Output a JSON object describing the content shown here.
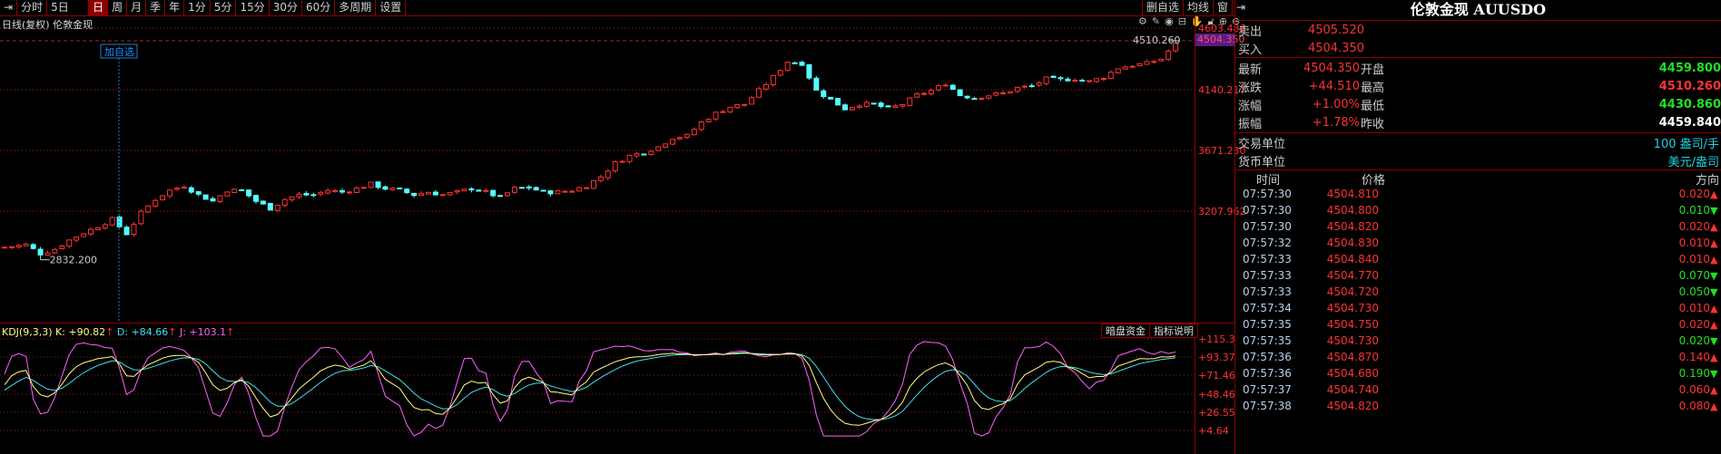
{
  "toolbar": {
    "items": [
      "分时",
      "5日",
      "日",
      "周",
      "月",
      "季",
      "年",
      "1分",
      "5分",
      "15分",
      "30分",
      "60分",
      "多周期",
      "设置"
    ],
    "active": "日",
    "right": [
      "删自选",
      "均线",
      "窗"
    ]
  },
  "chart": {
    "title": "日线(复权)  伦敦金现",
    "tag": "加自选",
    "high_label": "4510.260",
    "low_label": "2832.200",
    "icons": [
      "gear-icon",
      "pen-icon",
      "eye-icon",
      "toolbox-icon",
      "hand-icon",
      "lock-icon",
      "zoom-in-icon",
      "zoom-out-icon"
    ],
    "price_axis": [
      "4603.486",
      "4140.217",
      "3671.230",
      "3207.962"
    ],
    "current_price": "4504.350"
  },
  "chart_data": {
    "type": "candlestick",
    "title": "伦敦金现 日线(复权)",
    "ylim": [
      2832.2,
      4603.486
    ],
    "closes": [
      2935,
      2949,
      2879,
      2914,
      2984,
      3040,
      3089,
      3145,
      3033,
      3194,
      3299,
      3369,
      3404,
      3334,
      3285,
      3369,
      3369,
      3285,
      3229,
      3299,
      3334,
      3334,
      3369,
      3355,
      3383,
      3418,
      3383,
      3369,
      3334,
      3355,
      3334,
      3355,
      3383,
      3355,
      3313,
      3383,
      3390,
      3355,
      3355,
      3369,
      3404,
      3474,
      3579,
      3635,
      3663,
      3705,
      3775,
      3789,
      3894,
      3964,
      4013,
      4034,
      4139,
      4244,
      4363,
      4349,
      4139,
      4069,
      3999,
      4034,
      4034,
      3999,
      4034,
      4104,
      4139,
      4195,
      4104,
      4083,
      4104,
      4118,
      4160,
      4174,
      4230,
      4223,
      4230,
      4209,
      4244,
      4314,
      4335,
      4349,
      4384,
      4504
    ],
    "up_color": "#ff3232",
    "down_color": "#54ffff"
  },
  "kdj": {
    "name": "KDJ(9,3,3)",
    "k": "K: +90.82",
    "d": "D: +84.66",
    "j": "J: +103.1",
    "arrow": "↑",
    "buttons": [
      "暗盘资金",
      "指标说明"
    ],
    "axis": [
      "+115.3",
      "+93.37",
      "+71.46",
      "+48.46",
      "+26.55",
      "+4.64"
    ],
    "colors": {
      "k": "#ffff80",
      "d": "#40e0f0",
      "j": "#ff60ff"
    }
  },
  "panel": {
    "title": "伦敦金现 AUUSDO",
    "sell_label": "卖出",
    "sell": "4505.520",
    "buy_label": "买入",
    "buy": "4504.350",
    "stats": [
      [
        "最新",
        "4504.350",
        "开盘",
        "4459.800"
      ],
      [
        "涨跌",
        "+44.510",
        "最高",
        "4510.260"
      ],
      [
        "涨幅",
        "+1.00%",
        "最低",
        "4430.860"
      ],
      [
        "振幅",
        "+1.78%",
        "昨收",
        "4459.840"
      ]
    ],
    "trade_unit_label": "交易单位",
    "trade_unit": "100 盎司/手",
    "currency_label": "货币单位",
    "currency": "美元/盎司",
    "headers": [
      "时间",
      "价格",
      "方向"
    ],
    "ticks": [
      [
        "07:57:30",
        "4504.810",
        "0.020",
        "up"
      ],
      [
        "07:57:30",
        "4504.800",
        "0.010",
        "down"
      ],
      [
        "07:57:30",
        "4504.820",
        "0.020",
        "up"
      ],
      [
        "07:57:32",
        "4504.830",
        "0.010",
        "up"
      ],
      [
        "07:57:33",
        "4504.840",
        "0.010",
        "up"
      ],
      [
        "07:57:33",
        "4504.770",
        "0.070",
        "down"
      ],
      [
        "07:57:33",
        "4504.720",
        "0.050",
        "down"
      ],
      [
        "07:57:34",
        "4504.730",
        "0.010",
        "up"
      ],
      [
        "07:57:35",
        "4504.750",
        "0.020",
        "up"
      ],
      [
        "07:57:35",
        "4504.730",
        "0.020",
        "down"
      ],
      [
        "07:57:36",
        "4504.870",
        "0.140",
        "up"
      ],
      [
        "07:57:36",
        "4504.680",
        "0.190",
        "down"
      ],
      [
        "07:57:37",
        "4504.740",
        "0.060",
        "up"
      ],
      [
        "07:57:38",
        "4504.820",
        "0.080",
        "up"
      ]
    ]
  }
}
